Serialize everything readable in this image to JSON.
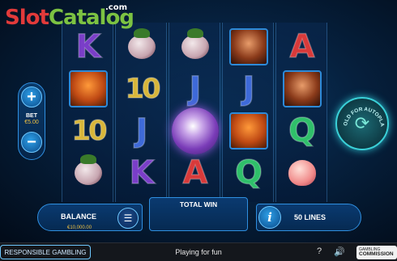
{
  "brand": {
    "slot": "Slot",
    "catalog": "Catalog",
    "com": ".com"
  },
  "reels": [
    {
      "symbols": [
        "K",
        "fox",
        "10",
        "mangosteen"
      ]
    },
    {
      "symbols": [
        "mangosteen",
        "10",
        "J",
        "K"
      ]
    },
    {
      "symbols": [
        "mangosteen",
        "J",
        "orb",
        "A"
      ]
    },
    {
      "symbols": [
        "monkey",
        "J",
        "fox",
        "Q"
      ]
    },
    {
      "symbols": [
        "A",
        "monkey",
        "Q",
        "peach"
      ]
    }
  ],
  "bet": {
    "plus": "+",
    "minus": "−",
    "label": "BET",
    "value": "€5.00"
  },
  "autoplay": {
    "label": "HOLD FOR AUTOPLAY"
  },
  "balance": {
    "label": "BALANCE",
    "value": "€10,000.00"
  },
  "total_win": {
    "label": "TOTAL WIN"
  },
  "info": {
    "glyph": "i"
  },
  "lines": {
    "label": "50 LINES"
  },
  "footer": {
    "responsible": "RESPONSIBLE GAMBLING",
    "playing": "Playing for fun",
    "help": "?",
    "sound": "🔊",
    "gc_line1": "GAMBLING",
    "gc_line2": "COMMISSION"
  },
  "colors": {
    "accent": "#2f8fe0",
    "gold": "#f0c040",
    "autoplay_glow": "#3ad0d8"
  }
}
